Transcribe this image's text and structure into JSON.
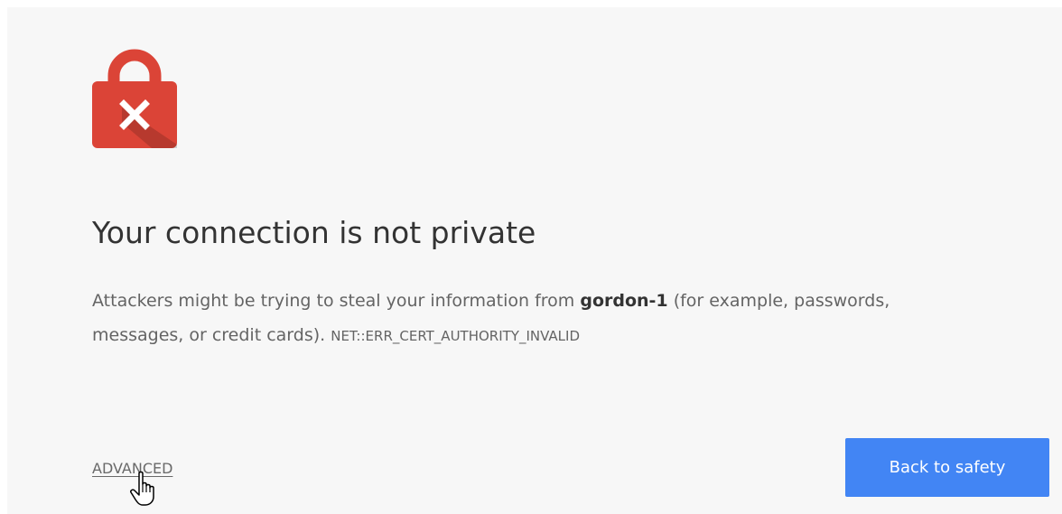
{
  "icon": "red-lock-error-icon",
  "colors": {
    "background": "#f7f7f7",
    "lock_red": "#db4437",
    "button_blue": "#4285f4",
    "text": "#646464",
    "heading": "#333333"
  },
  "interstitial": {
    "title": "Your connection is not private",
    "message_prefix": "Attackers might be trying to steal your information from ",
    "host": "gordon-1",
    "message_suffix": " (for example, passwords, messages, or credit cards). ",
    "error_code": "NET::ERR_CERT_AUTHORITY_INVALID",
    "advanced_label": "ADVANCED",
    "back_label": "Back to safety"
  },
  "cursor": "hand-pointer-cursor"
}
